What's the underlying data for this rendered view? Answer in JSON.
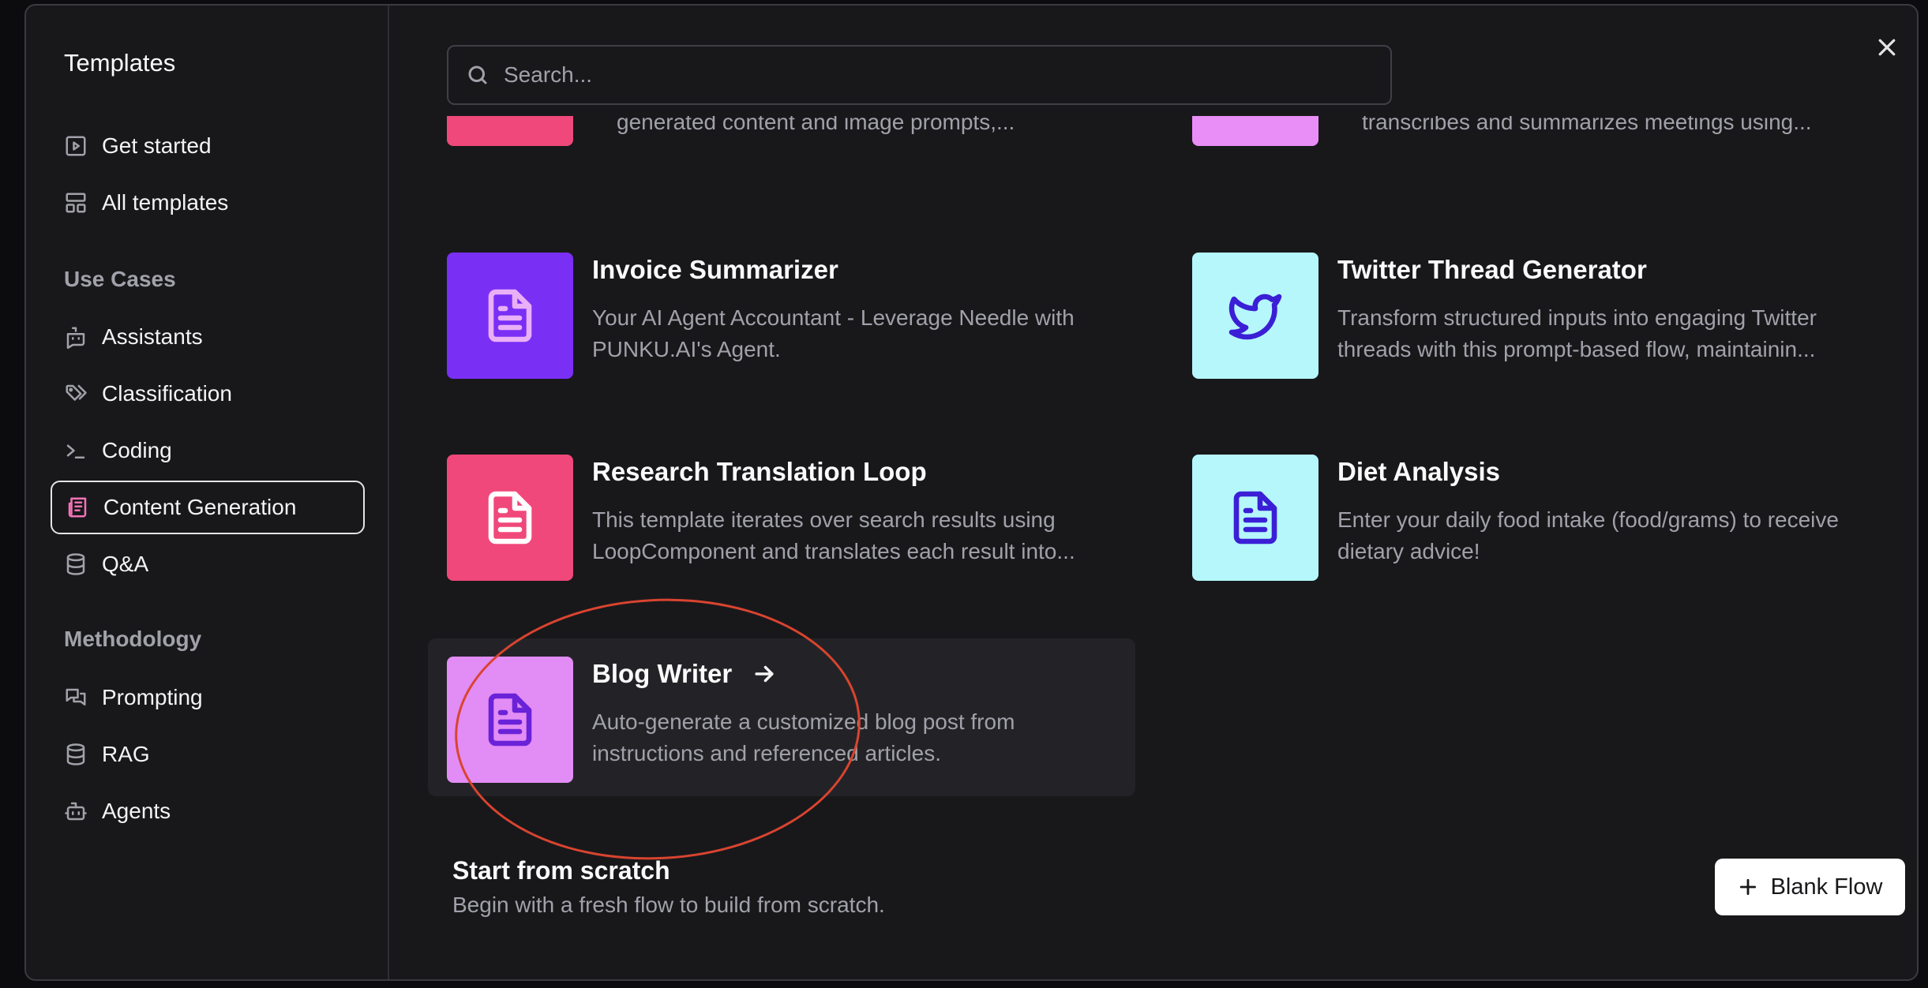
{
  "sidebar": {
    "title": "Templates",
    "top_items": [
      {
        "label": "Get started",
        "icon": "play-square-icon"
      },
      {
        "label": "All templates",
        "icon": "layout-grid-icon"
      }
    ],
    "use_cases_heading": "Use Cases",
    "use_cases": [
      {
        "label": "Assistants",
        "icon": "bot-message-icon"
      },
      {
        "label": "Classification",
        "icon": "tags-icon"
      },
      {
        "label": "Coding",
        "icon": "terminal-icon"
      },
      {
        "label": "Content Generation",
        "icon": "newspaper-icon",
        "active": true
      },
      {
        "label": "Q&A",
        "icon": "database-icon"
      }
    ],
    "methodology_heading": "Methodology",
    "methodology": [
      {
        "label": "Prompting",
        "icon": "messages-square-icon"
      },
      {
        "label": "RAG",
        "icon": "database-icon"
      },
      {
        "label": "Agents",
        "icon": "bot-icon"
      }
    ]
  },
  "search": {
    "placeholder": "Search..."
  },
  "partial_cards": [
    {
      "desc": "generated content and image prompts,...",
      "color": "#f0487a"
    },
    {
      "desc": "transcribes and summarizes meetings using...",
      "color": "#e98ef6"
    }
  ],
  "cards": [
    {
      "title": "Invoice Summarizer",
      "desc": "Your AI Agent Accountant - Leverage Needle with PUNKU.AI's Agent.",
      "bg": "#7a2ff5",
      "icon_color": "#e9b0f7",
      "icon": "file-text-icon"
    },
    {
      "title": "Twitter Thread Generator",
      "desc": "Transform structured inputs into engaging Twitter threads with this prompt-based flow, maintainin...",
      "bg": "#b5f7fb",
      "icon_color": "#3b1fd6",
      "icon": "twitter-icon"
    },
    {
      "title": "Research Translation Loop",
      "desc": "This template iterates over search results using LoopComponent and translates each result into...",
      "bg": "#f0487a",
      "icon_color": "#ffffff",
      "icon": "file-text-icon"
    },
    {
      "title": "Diet Analysis",
      "desc": "Enter your daily food intake (food/grams) to receive dietary advice!",
      "bg": "#b5f7fb",
      "icon_color": "#3b1fd6",
      "icon": "file-text-icon"
    },
    {
      "title": "Blog Writer",
      "desc": "Auto-generate a customized blog post from instructions and referenced articles.",
      "bg": "#e28cf5",
      "icon_color": "#6a22d8",
      "icon": "file-text-icon",
      "hovered": true
    }
  ],
  "scratch": {
    "title": "Start from scratch",
    "desc": "Begin with a fresh flow to build from scratch.",
    "button_label": "Blank Flow"
  }
}
